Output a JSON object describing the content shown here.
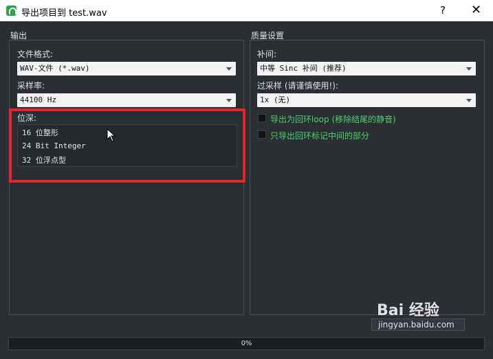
{
  "window": {
    "title": "导出项目到 test.wav",
    "help": "?",
    "close": "✕"
  },
  "output": {
    "group_title": "输出",
    "file_format_label": "文件格式:",
    "file_format_value": "WAV-文件 (*.wav)",
    "sample_rate_label": "采样率:",
    "sample_rate_value": "44100 Hz",
    "bit_depth_label": "位深:",
    "bit_depth_options": [
      "16 位整形",
      "24 Bit Integer",
      "32 位浮点型"
    ]
  },
  "quality": {
    "group_title": "质量设置",
    "interpolation_label": "补间:",
    "interpolation_value": "中等 Sinc 补间 (推荐)",
    "oversampling_label": "过采样 (请谨慎使用!):",
    "oversampling_value": "1x (无)",
    "export_loop_label": "导出为回环loop (移除结尾的静音)",
    "export_between_markers_label": "只导出回环标记中间的部分"
  },
  "progress": {
    "value": 0,
    "text": "0%"
  },
  "watermark": {
    "line1": "Bai 经验",
    "line2": "jingyan.baidu.com"
  },
  "colors": {
    "accent_green": "#4fd06f",
    "highlight_red": "#e3252c",
    "background": "#2b2e33"
  },
  "icons": {
    "app": "app-icon",
    "cursor": "mouse-pointer-icon"
  }
}
